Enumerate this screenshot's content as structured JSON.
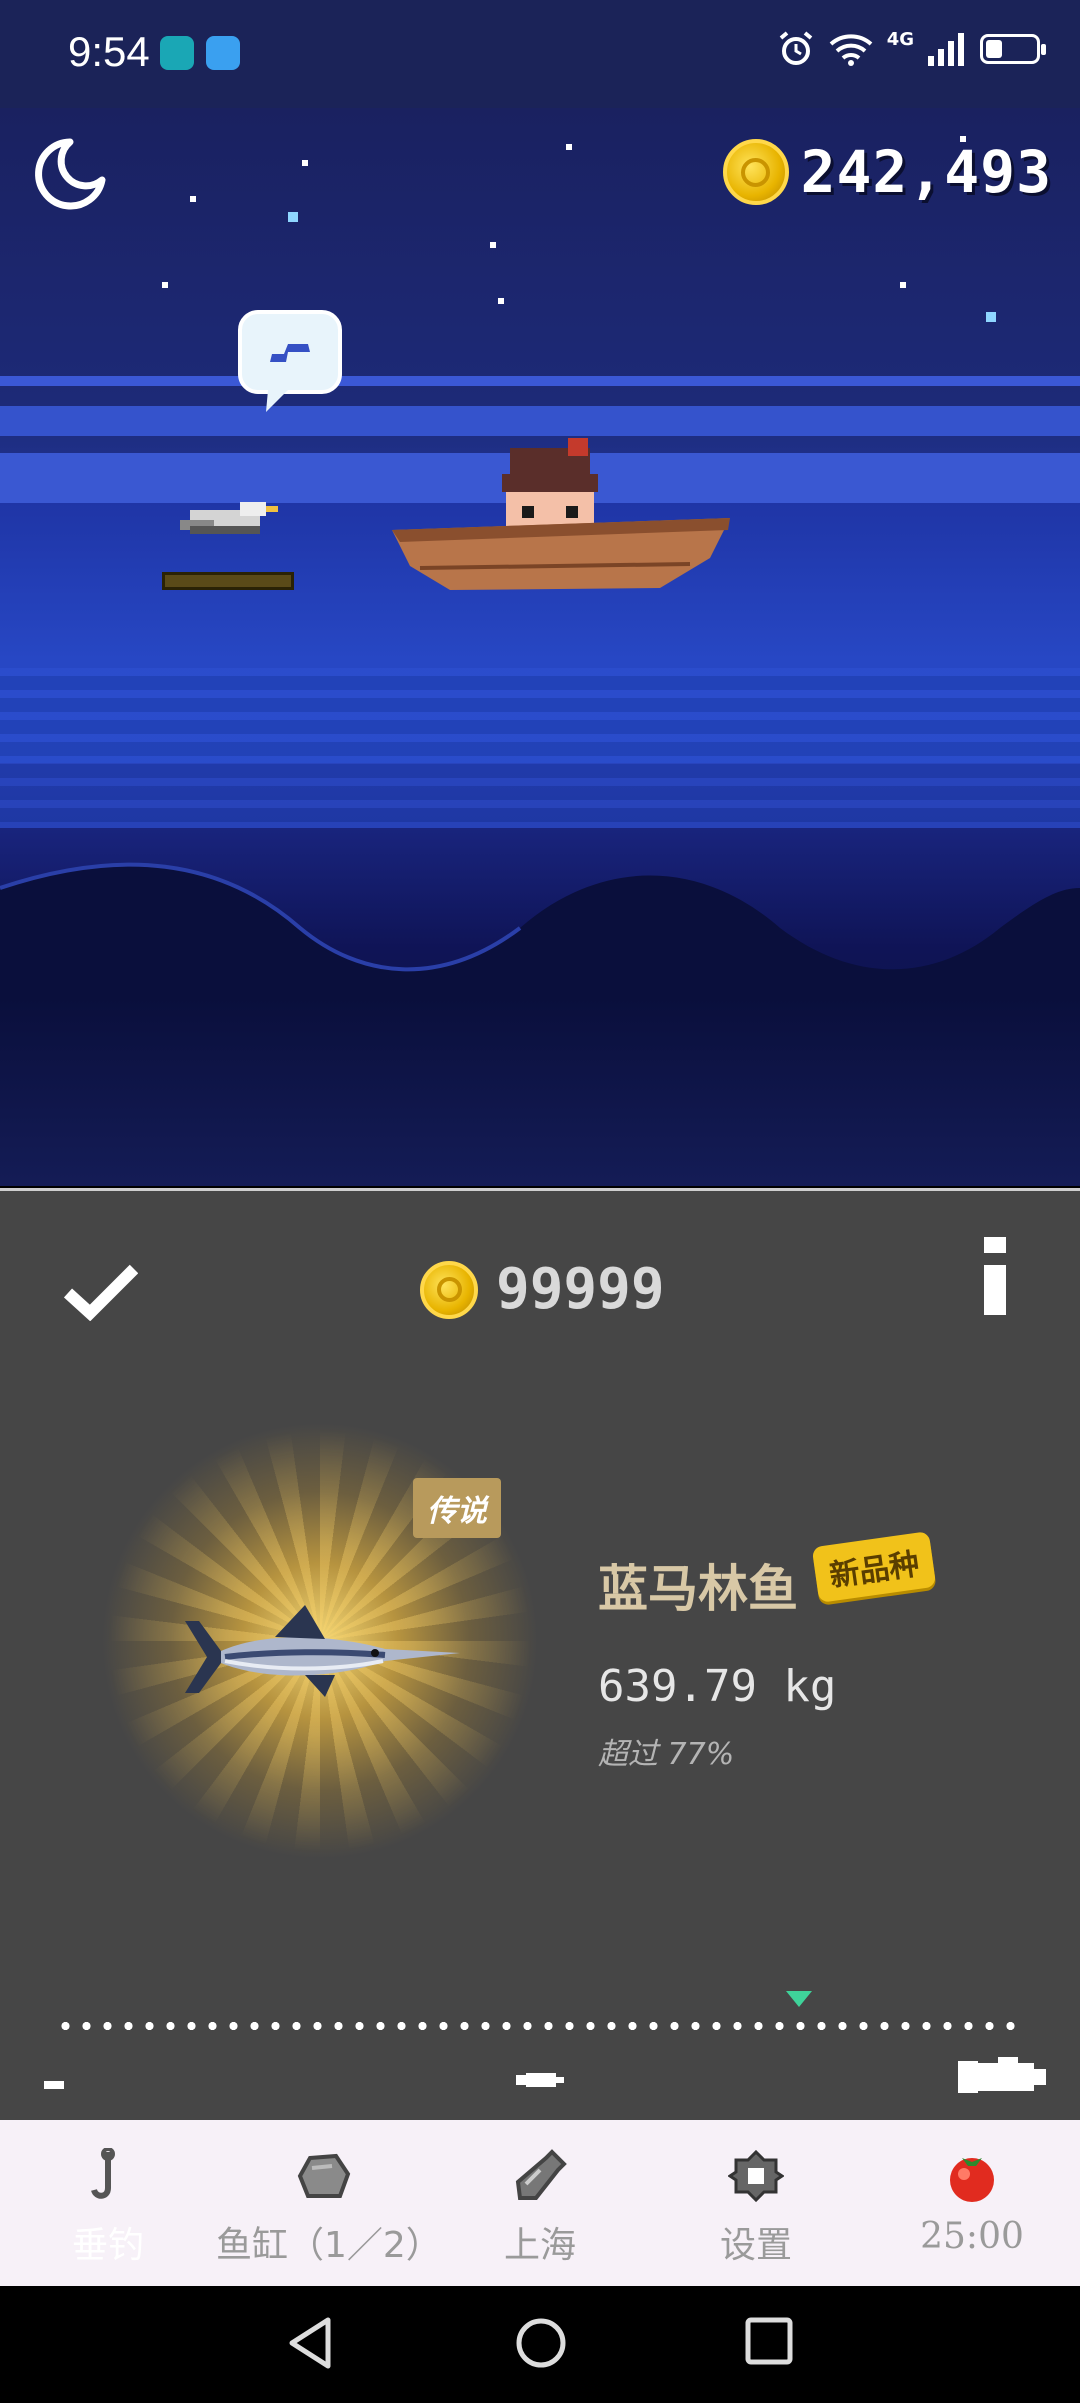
{
  "status_bar": {
    "time": "9:54",
    "network": "4G"
  },
  "top_bar": {
    "total_coins": "242,493"
  },
  "catch_panel": {
    "coins": "99999",
    "rarity_label": "传说",
    "fish_name": "蓝马林鱼",
    "new_badge": "新品种",
    "weight": "639.79 kg",
    "exceed_text": "超过 77%",
    "weight_percentile": 0.77
  },
  "nav": {
    "items": [
      {
        "label": "垂钓",
        "icon": "fishing-hook-icon",
        "active": true
      },
      {
        "label": "鱼缸（1／2）",
        "icon": "stone-icon",
        "active": false
      },
      {
        "label": "上海",
        "icon": "bottle-icon",
        "active": false
      },
      {
        "label": "设置",
        "icon": "gear-icon",
        "active": false
      },
      {
        "label": "25:00",
        "icon": "tomato-timer-icon",
        "active": false
      }
    ]
  },
  "colors": {
    "accent_gold": "#f1c21a",
    "panel_bg": "#464646",
    "sea_blue": "#2540b8"
  }
}
